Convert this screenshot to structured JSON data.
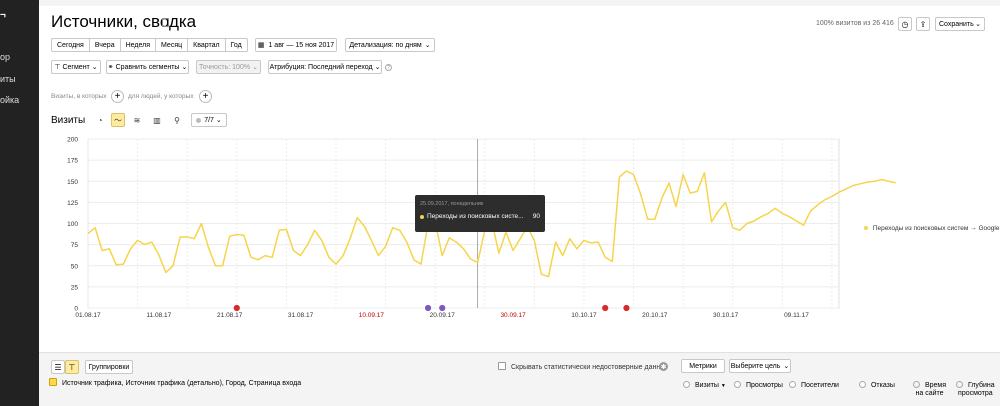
{
  "sidebar": {
    "items": [
      {
        "label": "ор"
      },
      {
        "label": "иты"
      },
      {
        "label": "ойка"
      }
    ]
  },
  "header": {
    "title": "Источники, сводка",
    "visits_pct": "100% визитов из 26 416",
    "save_label": "Сохранить"
  },
  "periods": [
    "Сегодня",
    "Вчера",
    "Неделя",
    "Месяц",
    "Квартал",
    "Год"
  ],
  "date_range": "1 авг — 15 ноя 2017",
  "detail": "Детализация: по дням",
  "segment_label": "Сегмент",
  "compare_label": "Сравнить сегменты",
  "accuracy_label": "Точность: 100%",
  "attribution_label": "Атрибуция: Последний переход",
  "hints": {
    "visits_where": "Визиты, в которых",
    "people_where": "для людей, у которых"
  },
  "chart_header": {
    "label": "Визиты",
    "series_counter": "7/7"
  },
  "tooltip": {
    "date": "25.09.2017, понедельник",
    "series": "Переходы из поисковых систе...",
    "value": "90"
  },
  "legend": "Переходы из поисковых систем → Google",
  "bottom": {
    "groupings_label": "Группировки",
    "hide_unreliable": "Скрывать статистически недостоверные данн...",
    "metrics_label": "Метрики",
    "goal_label": "Выберите цель",
    "dimensions": "Источник трафика, Источник трафика (детально), Город, Страница входа",
    "metrics": [
      "Визиты",
      "Просмотры",
      "Посетители",
      "Отказы"
    ],
    "metrics_two_line": [
      {
        "line1": "Время",
        "line2": "на сайте"
      },
      {
        "line1": "Глубина",
        "line2": "просмотра"
      }
    ]
  },
  "colors": {
    "series": "#f5d54a",
    "weekend_tick": "#c00000",
    "sidebar": "#222222",
    "active": "#ffeba0"
  },
  "chart_data": {
    "type": "line",
    "x_ticks": [
      "01.08.17",
      "11.08.17",
      "21.08.17",
      "31.08.17",
      "10.09.17",
      "20.09.17",
      "30.09.17",
      "10.10.17",
      "20.10.17",
      "30.10.17",
      "09.11.17"
    ],
    "x_ticks_weekend": [
      "10.09.17",
      "30.09.17"
    ],
    "y_ticks": [
      0,
      25,
      50,
      75,
      100,
      125,
      150,
      175,
      200
    ],
    "ylim": [
      0,
      200
    ],
    "xlim": [
      "2017-08-01",
      "2017-11-15"
    ],
    "grid": true,
    "legend_position": "right",
    "series": [
      {
        "name": "Переходы из поисковых систем → Google",
        "start": "2017-08-01",
        "values": [
          88,
          95,
          68,
          70,
          51,
          52,
          70,
          80,
          75,
          78,
          63,
          42,
          50,
          84,
          84,
          82,
          100,
          72,
          50,
          50,
          85,
          87,
          86,
          60,
          57,
          62,
          60,
          92,
          93,
          68,
          62,
          75,
          92,
          80,
          60,
          52,
          62,
          82,
          107,
          97,
          80,
          62,
          73,
          95,
          92,
          78,
          57,
          52,
          100,
          102,
          62,
          83,
          78,
          70,
          58,
          54,
          92,
          102,
          65,
          90,
          68,
          82,
          96,
          80,
          40,
          37,
          78,
          62,
          82,
          70,
          80,
          77,
          78,
          60,
          55,
          155,
          162,
          158,
          135,
          105,
          105,
          130,
          148,
          120,
          158,
          136,
          138,
          160,
          102,
          115,
          125,
          95,
          92,
          100,
          103,
          108,
          112,
          118,
          112,
          108,
          103,
          98,
          115,
          122,
          128,
          132,
          137,
          141,
          145,
          147,
          149,
          150,
          152,
          150,
          148
        ]
      }
    ],
    "annotations": [
      {
        "date": "2017-08-22",
        "type": "red"
      },
      {
        "date": "2017-09-18",
        "type": "violet"
      },
      {
        "date": "2017-09-20",
        "type": "violet"
      },
      {
        "date": "2017-10-13",
        "type": "red"
      },
      {
        "date": "2017-10-16",
        "type": "red"
      }
    ]
  }
}
